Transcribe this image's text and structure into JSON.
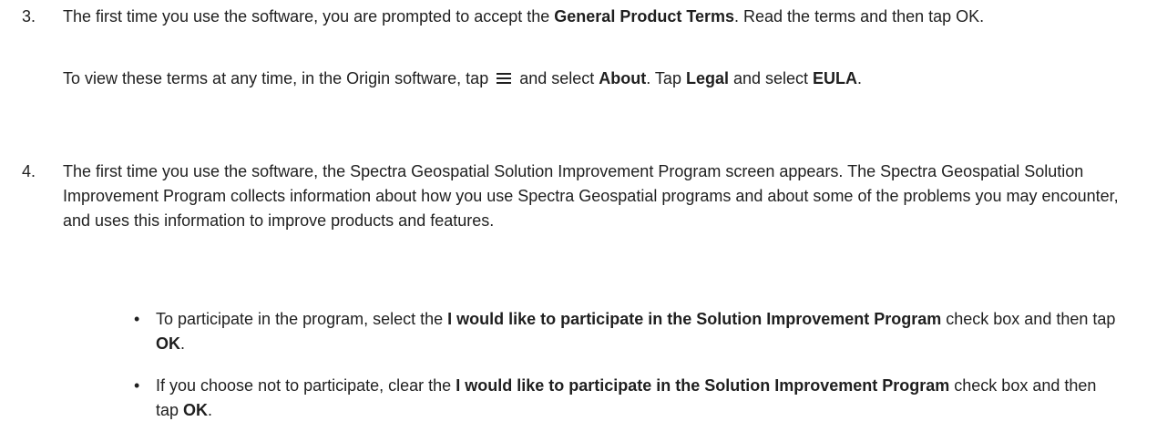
{
  "step3": {
    "number": "3.",
    "line1_a": "The first time you use the software, you are prompted to accept the ",
    "line1_b": "General Product Terms",
    "line1_c": ". Read the terms and then tap OK.",
    "line2_a": "To view these terms at any time, in the Origin software, tap ",
    "line2_icon": "menu-icon",
    "line2_b": " and select ",
    "line2_c": "About",
    "line2_d": ". Tap ",
    "line2_e": "Legal",
    "line2_f": " and select ",
    "line2_g": "EULA",
    "line2_h": "."
  },
  "step4": {
    "number": "4.",
    "text": "The first time you use the software, the Spectra Geospatial Solution Improvement Program screen appears. The Spectra Geospatial Solution Improvement Program collects information about how you use Spectra Geospatial programs and about some of the problems you may encounter, and uses this information to improve products and features.",
    "bullets": [
      {
        "a": "To participate in the program, select the ",
        "b": "I would like to participate in the Solution Improvement Program",
        "c": " check box and then tap ",
        "d": "OK",
        "e": "."
      },
      {
        "a": "If you choose not to participate, clear the ",
        "b": "I would like to participate in the Solution Improvement Program",
        "c": " check box and then tap ",
        "d": "OK",
        "e": "."
      }
    ]
  }
}
